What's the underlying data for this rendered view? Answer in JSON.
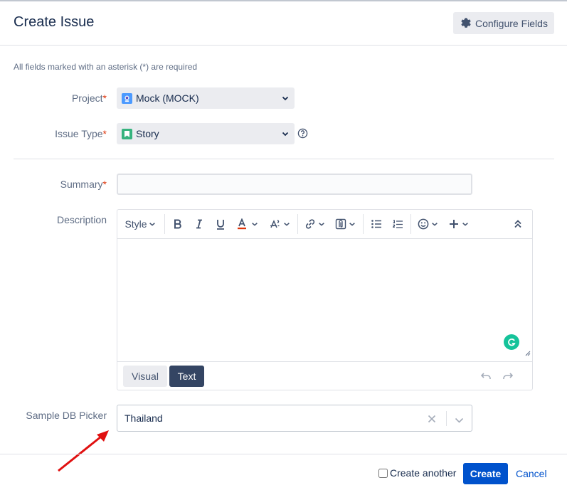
{
  "dialog": {
    "title": "Create Issue",
    "configure_label": "Configure Fields",
    "required_note": "All fields marked with an asterisk (*) are required"
  },
  "project": {
    "label": "Project",
    "value": "Mock (MOCK)"
  },
  "issue_type": {
    "label": "Issue Type",
    "value": "Story"
  },
  "summary": {
    "label": "Summary",
    "value": ""
  },
  "description": {
    "label": "Description",
    "style_label": "Style",
    "modes": {
      "visual": "Visual",
      "text": "Text"
    },
    "active_mode": "Text"
  },
  "db_picker": {
    "label": "Sample DB Picker",
    "value": "Thailand"
  },
  "footer": {
    "create_another_label": "Create another",
    "create_another_checked": false,
    "create_label": "Create",
    "cancel_label": "Cancel"
  },
  "colors": {
    "primary": "#0052cc",
    "required": "#de350b",
    "annotation_arrow": "#e01010",
    "grammarly": "#15c39a"
  }
}
